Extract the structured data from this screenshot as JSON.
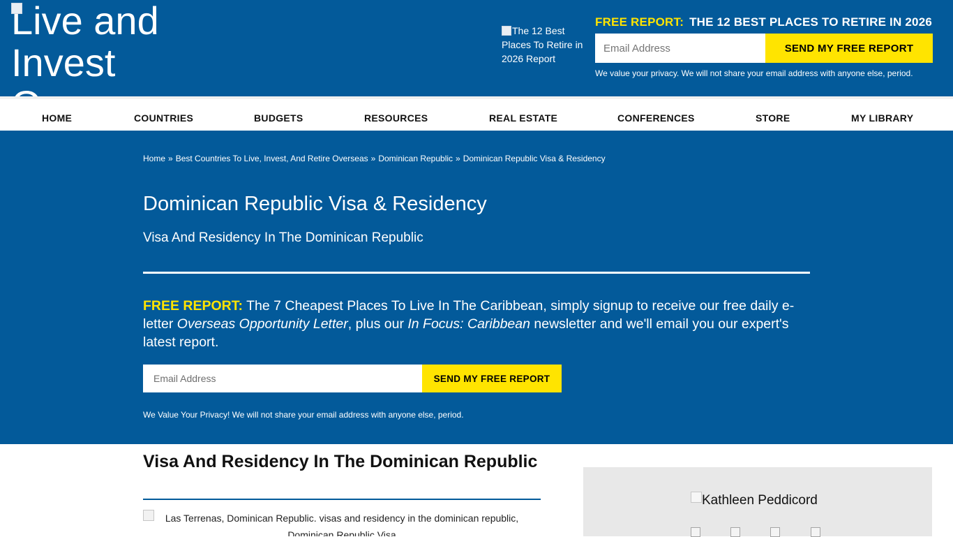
{
  "header": {
    "logo_alt": "Live and Invest Overseas",
    "report_cover_alt": "The 12 Best Places To Retire in 2026 Report",
    "free_report_label": "FREE REPORT:",
    "free_report_title": "THE 12 BEST PLACES TO RETIRE IN 2026",
    "email_placeholder": "Email Address",
    "submit_label": "SEND MY FREE REPORT",
    "privacy_text": "We value your privacy. We will not share your email address with anyone else, period."
  },
  "nav": {
    "items": [
      "HOME",
      "COUNTRIES",
      "BUDGETS",
      "RESOURCES",
      "REAL ESTATE",
      "CONFERENCES",
      "STORE",
      "MY LIBRARY"
    ]
  },
  "breadcrumb": {
    "items": [
      "Home",
      "Best Countries To Live, Invest, And Retire Overseas",
      "Dominican Republic",
      "Dominican Republic Visa & Residency"
    ],
    "separator": "»"
  },
  "hero": {
    "title": "Dominican Republic Visa & Residency",
    "subtitle": "Visa And Residency In The Dominican Republic",
    "promo_label": "FREE REPORT:",
    "promo_text_1": " The 7 Cheapest Places To Live In The Caribbean, simply signup to receive our free daily e-letter ",
    "promo_italic_1": "Overseas Opportunity Letter",
    "promo_text_2": ", plus our ",
    "promo_italic_2": "In Focus: Caribbean",
    "promo_text_3": " newsletter and we'll email you our expert's latest report.",
    "email_placeholder": "Email Address",
    "submit_label": "SEND MY FREE REPORT",
    "privacy_text": "We Value Your Privacy! We will not share your email address with anyone else, period."
  },
  "main": {
    "heading": "Visa And Residency In The Dominican Republic",
    "image_alt": "Las Terrenas, Dominican Republic. visas and residency in the dominican republic, Dominican Republic Visa"
  },
  "sidebar": {
    "author_alt": "Kathleen Peddicord"
  },
  "colors": {
    "brand_blue": "#035a9a",
    "accent_yellow": "#ffe400"
  }
}
